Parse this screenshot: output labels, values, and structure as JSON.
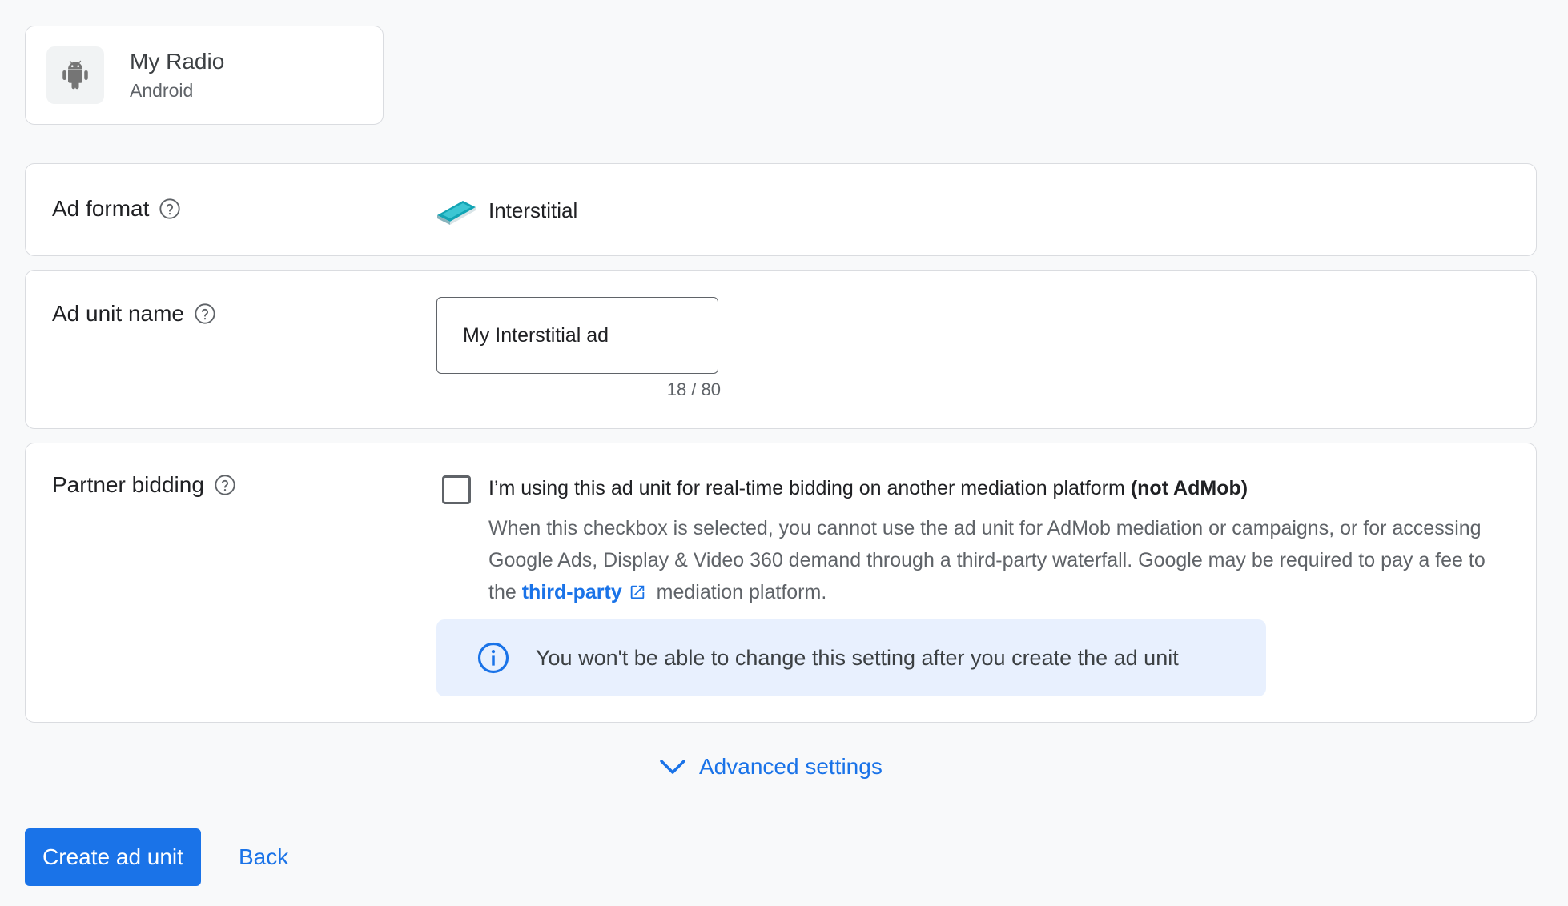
{
  "app": {
    "name": "My Radio",
    "platform": "Android",
    "icon": "android-icon"
  },
  "ad_format": {
    "label": "Ad format",
    "value": "Interstitial",
    "icon": "interstitial-format-icon"
  },
  "ad_unit_name": {
    "label": "Ad unit name",
    "value": "My Interstitial ad",
    "char_count": "18 / 80"
  },
  "partner_bidding": {
    "label": "Partner bidding",
    "checkbox_checked": false,
    "checkbox_label": "I’m using this ad unit for real-time bidding on another mediation platform",
    "checkbox_label_bold": "(not AdMob)",
    "description_before_link": "When this checkbox is selected, you cannot use the ad unit for AdMob mediation or campaigns, or for accessing Google Ads, Display & Video 360 demand through a third-party waterfall. Google may be required to pay a fee to the",
    "link_text": "third-party",
    "description_after_link": "mediation platform.",
    "info_banner": "You won't be able to change this setting after you create the ad unit"
  },
  "advanced_settings_label": "Advanced settings",
  "actions": {
    "create_label": "Create ad unit",
    "back_label": "Back"
  },
  "colors": {
    "primary": "#1a73e8",
    "banner_bg": "#e8f0fe",
    "border": "#dadce0",
    "page_bg": "#f8f9fa"
  }
}
